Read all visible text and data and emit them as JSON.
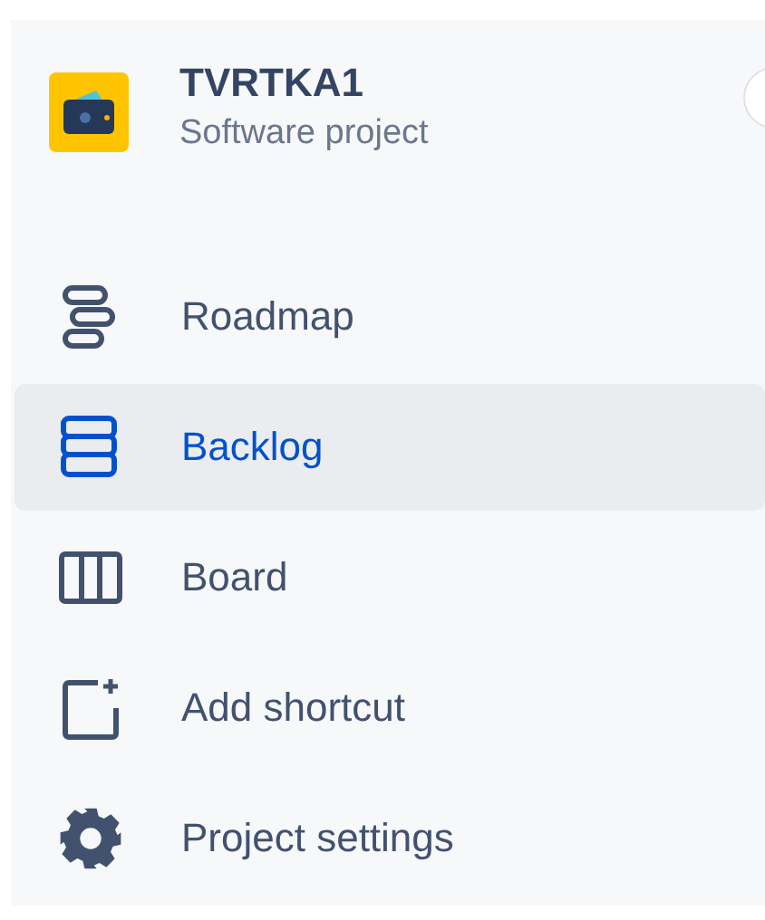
{
  "project": {
    "name": "TVRTKA1",
    "type": "Software project"
  },
  "nav_items": [
    {
      "label": "Roadmap",
      "kind": "roadmap",
      "selected": false
    },
    {
      "label": "Backlog",
      "kind": "backlog",
      "selected": true
    },
    {
      "label": "Board",
      "kind": "board",
      "selected": false
    },
    {
      "label": "Add shortcut",
      "kind": "shortcut",
      "selected": false
    },
    {
      "label": "Project settings",
      "kind": "settings",
      "selected": false
    }
  ]
}
